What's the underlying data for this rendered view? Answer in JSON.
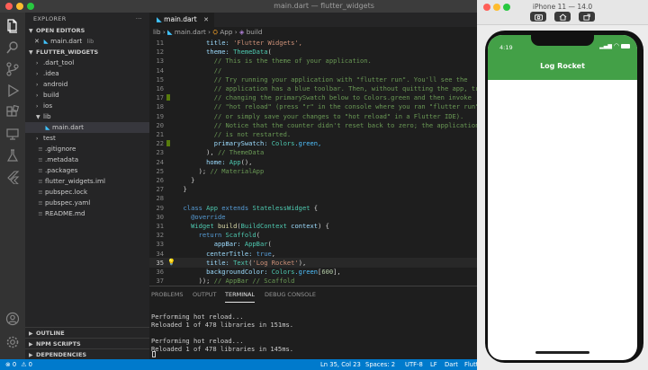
{
  "window": {
    "title": "main.dart — flutter_widgets"
  },
  "explorer": {
    "header": "EXPLORER",
    "open_editors": {
      "label": "OPEN EDITORS",
      "file": "main.dart",
      "path": "lib"
    },
    "project": "FLUTTER_WIDGETS",
    "items": [
      {
        "name": ".dart_tool",
        "type": "folder",
        "indent": 1
      },
      {
        "name": ".idea",
        "type": "folder",
        "indent": 1
      },
      {
        "name": "android",
        "type": "folder",
        "indent": 1
      },
      {
        "name": "build",
        "type": "folder",
        "indent": 1
      },
      {
        "name": "ios",
        "type": "folder",
        "indent": 1
      },
      {
        "name": "lib",
        "type": "folder-open",
        "indent": 1
      },
      {
        "name": "main.dart",
        "type": "dart",
        "indent": 2,
        "selected": true
      },
      {
        "name": "test",
        "type": "folder",
        "indent": 1
      },
      {
        "name": ".gitignore",
        "type": "file",
        "indent": 1
      },
      {
        "name": ".metadata",
        "type": "file",
        "indent": 1
      },
      {
        "name": ".packages",
        "type": "file",
        "indent": 1
      },
      {
        "name": "flutter_widgets.iml",
        "type": "file",
        "indent": 1
      },
      {
        "name": "pubspec.lock",
        "type": "file",
        "indent": 1
      },
      {
        "name": "pubspec.yaml",
        "type": "file",
        "indent": 1
      },
      {
        "name": "README.md",
        "type": "file",
        "indent": 1
      }
    ],
    "bottom_sections": [
      "OUTLINE",
      "NPM SCRIPTS",
      "DEPENDENCIES"
    ]
  },
  "editor": {
    "tab": "main.dart",
    "breadcrumb": [
      "lib",
      "main.dart",
      "App",
      "build"
    ],
    "current_line": 35,
    "lines": [
      {
        "n": 11,
        "tokens": [
          [
            "        title: ",
            "p"
          ],
          [
            "'Flutter Widgets',",
            "s"
          ]
        ]
      },
      {
        "n": 12,
        "tokens": [
          [
            "        theme: ",
            "p"
          ],
          [
            "ThemeData",
            "t"
          ],
          [
            "(",
            ""
          ]
        ]
      },
      {
        "n": 13,
        "tokens": [
          [
            "          // This is the theme of your application.",
            "c"
          ]
        ]
      },
      {
        "n": 14,
        "tokens": [
          [
            "          //",
            "c"
          ]
        ]
      },
      {
        "n": 15,
        "tokens": [
          [
            "          // Try running your application with \"flutter run\". You'll see the",
            "c"
          ]
        ]
      },
      {
        "n": 16,
        "tokens": [
          [
            "          // application has a blue toolbar. Then, without quitting the app, try",
            "c"
          ]
        ]
      },
      {
        "n": 17,
        "tokens": [
          [
            "          // changing the primarySwatch below to Colors.green and then invoke",
            "c"
          ]
        ],
        "mark": true
      },
      {
        "n": 18,
        "tokens": [
          [
            "          // \"hot reload\" (press \"r\" in the console where you ran \"flutter run\",",
            "c"
          ]
        ]
      },
      {
        "n": 19,
        "tokens": [
          [
            "          // or simply save your changes to \"hot reload\" in a Flutter IDE).",
            "c"
          ]
        ]
      },
      {
        "n": 20,
        "tokens": [
          [
            "          // Notice that the counter didn't reset back to zero; the application",
            "c"
          ]
        ]
      },
      {
        "n": 21,
        "tokens": [
          [
            "          // is not restarted.",
            "c"
          ]
        ]
      },
      {
        "n": 22,
        "tokens": [
          [
            "          primarySwatch: ",
            "p"
          ],
          [
            "Colors",
            "t"
          ],
          [
            ".green,",
            "v"
          ]
        ],
        "mark": true
      },
      {
        "n": 23,
        "tokens": [
          [
            "        ), ",
            ""
          ],
          [
            "// ThemeData",
            "c"
          ]
        ]
      },
      {
        "n": 24,
        "tokens": [
          [
            "        home: ",
            "p"
          ],
          [
            "App",
            "t"
          ],
          [
            "(),",
            ""
          ]
        ]
      },
      {
        "n": 25,
        "tokens": [
          [
            "      ); ",
            ""
          ],
          [
            "// MaterialApp",
            "c"
          ]
        ]
      },
      {
        "n": 26,
        "tokens": [
          [
            "    }",
            ""
          ]
        ]
      },
      {
        "n": 27,
        "tokens": [
          [
            "  }",
            ""
          ]
        ]
      },
      {
        "n": 28,
        "tokens": [
          [
            "",
            ""
          ]
        ]
      },
      {
        "n": 29,
        "tokens": [
          [
            "  class ",
            "k"
          ],
          [
            "App ",
            "t"
          ],
          [
            "extends ",
            "k"
          ],
          [
            "StatelessWidget ",
            "t"
          ],
          [
            "{",
            ""
          ]
        ]
      },
      {
        "n": 30,
        "tokens": [
          [
            "    @override",
            "k"
          ]
        ]
      },
      {
        "n": 31,
        "tokens": [
          [
            "    ",
            ""
          ],
          [
            "Widget ",
            "t"
          ],
          [
            "build",
            "f"
          ],
          [
            "(",
            ""
          ],
          [
            "BuildContext ",
            "t"
          ],
          [
            "context",
            "p"
          ],
          [
            ") {",
            ""
          ]
        ]
      },
      {
        "n": 32,
        "tokens": [
          [
            "      return ",
            "k"
          ],
          [
            "Scaffold",
            "t"
          ],
          [
            "(",
            ""
          ]
        ]
      },
      {
        "n": 33,
        "tokens": [
          [
            "          appBar: ",
            "p"
          ],
          [
            "AppBar",
            "t"
          ],
          [
            "(",
            ""
          ]
        ]
      },
      {
        "n": 34,
        "tokens": [
          [
            "        centerTitle: ",
            "p"
          ],
          [
            "true",
            "k"
          ],
          [
            ",",
            ""
          ]
        ]
      },
      {
        "n": 35,
        "tokens": [
          [
            "        title: ",
            "p"
          ],
          [
            "Text",
            "t"
          ],
          [
            "(",
            ""
          ],
          [
            "'Log Rocket'",
            "s"
          ],
          [
            "),",
            ""
          ]
        ],
        "bulb": true
      },
      {
        "n": 36,
        "tokens": [
          [
            "        backgroundColor: ",
            "p"
          ],
          [
            "Colors",
            "t"
          ],
          [
            ".green",
            "v"
          ],
          [
            "[",
            ""
          ],
          [
            "600",
            "n"
          ],
          [
            "],",
            ""
          ]
        ]
      },
      {
        "n": 37,
        "tokens": [
          [
            "      )); ",
            ""
          ],
          [
            "// AppBar // Scaffold",
            "c"
          ]
        ]
      }
    ]
  },
  "panel": {
    "tabs": [
      "PROBLEMS",
      "OUTPUT",
      "TERMINAL",
      "DEBUG CONSOLE"
    ],
    "active_tab": "TERMINAL",
    "terminal_lines": [
      "Performing hot reload...",
      "Reloaded 1 of 478 libraries in 151ms.",
      "",
      "Performing hot reload...",
      "Reloaded 1 of 478 libraries in 145ms."
    ]
  },
  "statusbar": {
    "errors": "0",
    "warnings": "0",
    "position": "Ln 35, Col 23",
    "spaces": "Spaces: 2",
    "encoding": "UTF-8",
    "eol": "LF",
    "language": "Dart",
    "flutter": "Flutter"
  },
  "simulator": {
    "title": "iPhone 11 — 14.0",
    "time": "4:19",
    "app_title": "Log Rocket",
    "appbar_color": "#43a047"
  },
  "colors": {
    "accent": "#007acc",
    "sidebar": "#252526",
    "editor": "#1e1e1e",
    "activitybar": "#333333"
  }
}
